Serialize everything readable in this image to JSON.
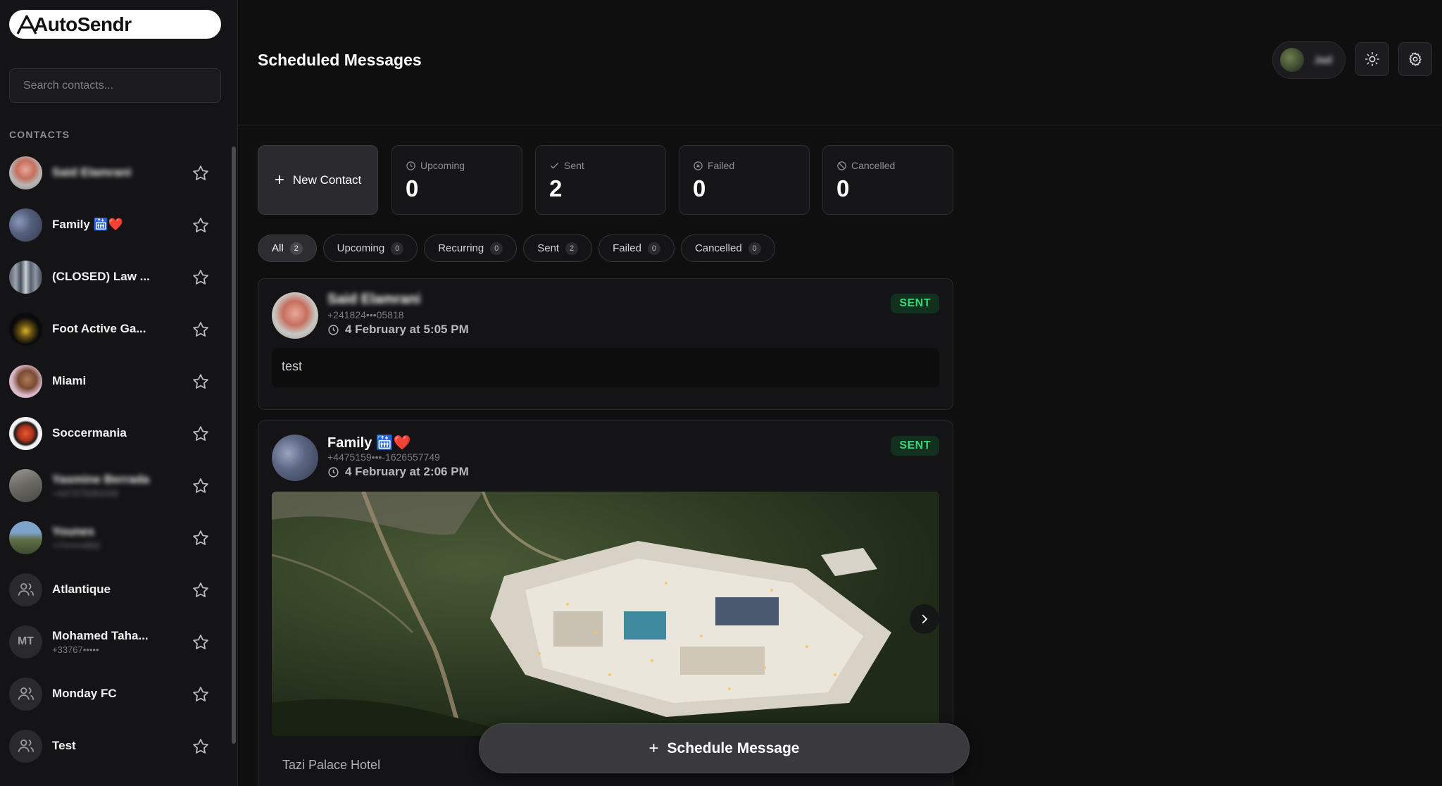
{
  "app": {
    "name": "AutoSendr"
  },
  "sidebar": {
    "search_placeholder": "Search contacts...",
    "contacts_title": "CONTACTS",
    "contacts": [
      {
        "name": "Said Elamrani",
        "phone": "",
        "avatar": "photo",
        "blurred": true
      },
      {
        "name": "Family 🛗❤️",
        "phone": "",
        "avatar": "photo",
        "blurred": false
      },
      {
        "name": "(CLOSED) Law ...",
        "phone": "",
        "avatar": "photo",
        "blurred": false
      },
      {
        "name": "Foot Active Ga...",
        "phone": "",
        "avatar": "photo",
        "blurred": false
      },
      {
        "name": "Miami",
        "phone": "",
        "avatar": "photo",
        "blurred": false
      },
      {
        "name": "Soccermania",
        "phone": "",
        "avatar": "photo",
        "blurred": false
      },
      {
        "name": "Yasmine Berrada",
        "phone": "+447375081030",
        "avatar": "photo",
        "blurred": true
      },
      {
        "name": "Younes",
        "phone": "+7•••••••692",
        "avatar": "photo",
        "blurred": true
      },
      {
        "name": "Atlantique",
        "phone": "",
        "avatar": "group-icon",
        "blurred": false
      },
      {
        "name": "Mohamed Taha...",
        "phone": "+33767•••••",
        "avatar": "MT",
        "blurred": false
      },
      {
        "name": "Monday FC",
        "phone": "",
        "avatar": "group-icon",
        "blurred": false
      },
      {
        "name": "Test",
        "phone": "",
        "avatar": "group-icon",
        "blurred": false
      }
    ]
  },
  "header": {
    "title": "Scheduled Messages",
    "user_name": "Jad"
  },
  "stats": {
    "new_contact_label": "New Contact",
    "items": [
      {
        "label": "Upcoming",
        "value": "0",
        "icon": "clock-icon"
      },
      {
        "label": "Sent",
        "value": "2",
        "icon": "check-icon"
      },
      {
        "label": "Failed",
        "value": "0",
        "icon": "x-circle-icon"
      },
      {
        "label": "Cancelled",
        "value": "0",
        "icon": "ban-icon"
      }
    ]
  },
  "filters": [
    {
      "label": "All",
      "count": "2",
      "active": true
    },
    {
      "label": "Upcoming",
      "count": "0",
      "active": false
    },
    {
      "label": "Recurring",
      "count": "0",
      "active": false
    },
    {
      "label": "Sent",
      "count": "2",
      "active": false
    },
    {
      "label": "Failed",
      "count": "0",
      "active": false
    },
    {
      "label": "Cancelled",
      "count": "0",
      "active": false
    }
  ],
  "messages": [
    {
      "name": "Said Elamrani",
      "phone": "+241824•••05818",
      "date": "4 February at 5:05 PM",
      "status": "SENT",
      "body": "test"
    },
    {
      "name": "Family 🛗❤️",
      "phone": "+4475159•••-1626557749",
      "date": "4 February at 2:06 PM",
      "status": "SENT",
      "caption": "Tazi Palace Hotel"
    }
  ],
  "actions": {
    "schedule_label": "Schedule Message"
  },
  "colors": {
    "accent_sent": "#3ad47a",
    "background": "#0f0f10",
    "panel": "#141416"
  }
}
